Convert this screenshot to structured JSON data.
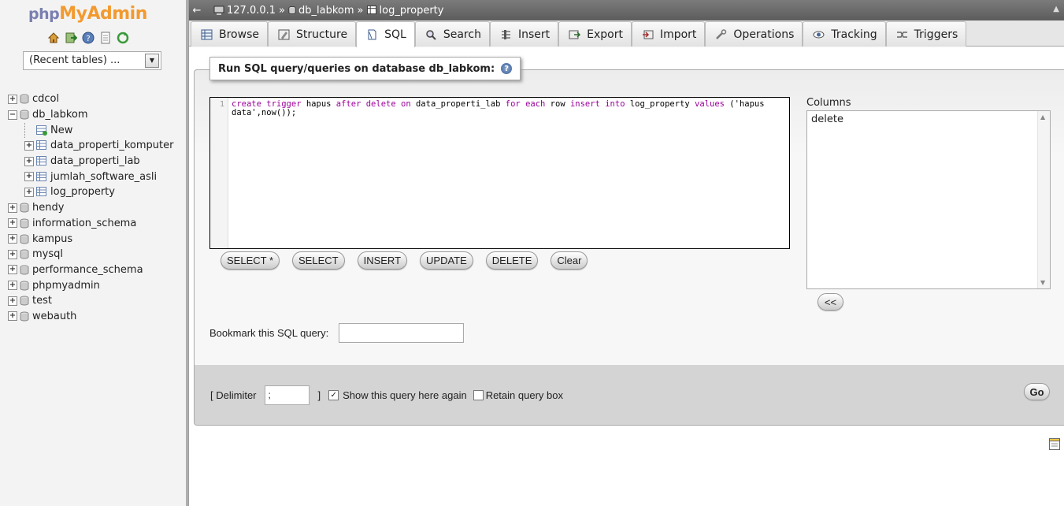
{
  "logo": {
    "php": "php",
    "myadmin": "MyAdmin"
  },
  "nav_icons": [
    "home-icon",
    "exit-icon",
    "query-help-icon",
    "docs-icon",
    "reload-icon"
  ],
  "recent_tables": {
    "selected": "(Recent tables) ..."
  },
  "tree": {
    "databases": [
      {
        "name": "cdcol",
        "expanded": false
      },
      {
        "name": "db_labkom",
        "expanded": true
      },
      {
        "name": "hendy",
        "expanded": false
      },
      {
        "name": "information_schema",
        "expanded": false
      },
      {
        "name": "kampus",
        "expanded": false
      },
      {
        "name": "mysql",
        "expanded": false
      },
      {
        "name": "performance_schema",
        "expanded": false
      },
      {
        "name": "phpmyadmin",
        "expanded": false
      },
      {
        "name": "test",
        "expanded": false
      },
      {
        "name": "webauth",
        "expanded": false
      }
    ],
    "db_labkom_children": [
      "New",
      "data_properti_komputer",
      "data_properti_lab",
      "jumlah_software_asli",
      "log_property"
    ]
  },
  "breadcrumb": {
    "back": "←",
    "server": "127.0.0.1",
    "sep": "»",
    "database": "db_labkom",
    "table": "log_property"
  },
  "tabs": [
    {
      "label": "Browse",
      "icon": "browse-icon"
    },
    {
      "label": "Structure",
      "icon": "structure-icon"
    },
    {
      "label": "SQL",
      "icon": "sql-icon",
      "active": true
    },
    {
      "label": "Search",
      "icon": "search-icon"
    },
    {
      "label": "Insert",
      "icon": "insert-icon"
    },
    {
      "label": "Export",
      "icon": "export-icon"
    },
    {
      "label": "Import",
      "icon": "import-icon"
    },
    {
      "label": "Operations",
      "icon": "operations-icon"
    },
    {
      "label": "Tracking",
      "icon": "tracking-icon"
    },
    {
      "label": "Triggers",
      "icon": "triggers-icon"
    }
  ],
  "sql_panel": {
    "legend": "Run SQL query/queries on database db_labkom:",
    "line_number": "1",
    "query_tokens": [
      {
        "t": "create",
        "c": "kw"
      },
      {
        "t": " "
      },
      {
        "t": "trigger",
        "c": "kw"
      },
      {
        "t": " hapus "
      },
      {
        "t": "after",
        "c": "kw"
      },
      {
        "t": " "
      },
      {
        "t": "delete",
        "c": "kw"
      },
      {
        "t": " "
      },
      {
        "t": "on",
        "c": "kw"
      },
      {
        "t": " data_properti_lab "
      },
      {
        "t": "for",
        "c": "kw"
      },
      {
        "t": " "
      },
      {
        "t": "each",
        "c": "kw"
      },
      {
        "t": " row "
      },
      {
        "t": "insert",
        "c": "kw"
      },
      {
        "t": " "
      },
      {
        "t": "into",
        "c": "kw"
      },
      {
        "t": " log_property "
      },
      {
        "t": "values",
        "c": "kw"
      },
      {
        "t": " ('hapus data',now());"
      }
    ],
    "buttons": [
      "SELECT *",
      "SELECT",
      "INSERT",
      "UPDATE",
      "DELETE",
      "Clear"
    ],
    "columns_label": "Columns",
    "columns": [
      "delete"
    ],
    "insert_column_button": "<<",
    "bookmark_label": "Bookmark this SQL query:",
    "bookmark_value": ""
  },
  "footer": {
    "delimiter_label_open": "[ Delimiter",
    "delimiter_value": ";",
    "delimiter_label_close": "]",
    "show_query_label": "Show this query here again",
    "show_query_checked": true,
    "retain_label": "Retain query box",
    "retain_checked": false,
    "go_label": "Go"
  }
}
